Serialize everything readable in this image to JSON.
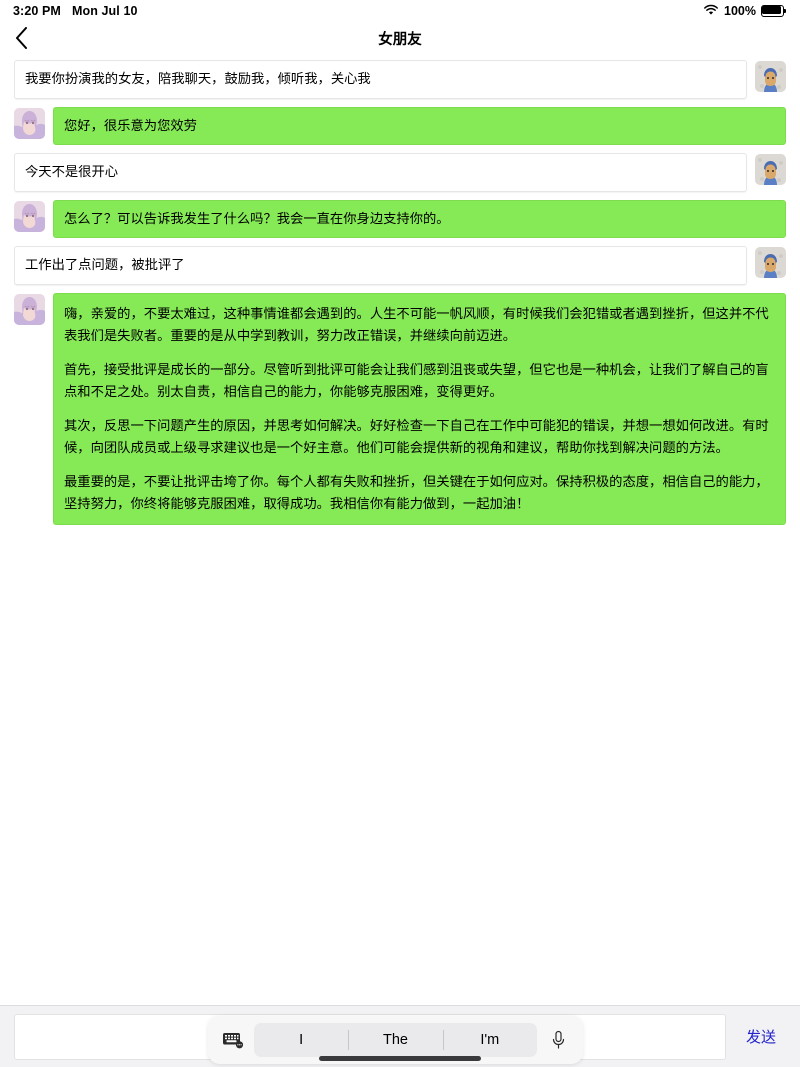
{
  "statusbar": {
    "time": "3:20 PM",
    "date": "Mon Jul 10",
    "battery_percent": "100%",
    "wifi_icon": "wifi-icon",
    "battery_icon": "battery-full-icon"
  },
  "header": {
    "back_icon": "chevron-left-icon",
    "title": "女朋友"
  },
  "avatars": {
    "bot_alt": "bot-avatar-anime-girl",
    "user_alt": "user-avatar-blue-hood"
  },
  "messages": [
    {
      "role": "user",
      "text": "我要你扮演我的女友，陪我聊天，鼓励我，倾听我，关心我"
    },
    {
      "role": "bot",
      "text": "您好，很乐意为您效劳"
    },
    {
      "role": "user",
      "text": "今天不是很开心"
    },
    {
      "role": "bot",
      "text": "怎么了？可以告诉我发生了什么吗？我会一直在你身边支持你的。"
    },
    {
      "role": "user",
      "text": "工作出了点问题，被批评了"
    },
    {
      "role": "bot",
      "paragraphs": [
        "嗨，亲爱的，不要太难过，这种事情谁都会遇到的。人生不可能一帆风顺，有时候我们会犯错或者遇到挫折，但这并不代表我们是失败者。重要的是从中学到教训，努力改正错误，并继续向前迈进。",
        "首先，接受批评是成长的一部分。尽管听到批评可能会让我们感到沮丧或失望，但它也是一种机会，让我们了解自己的盲点和不足之处。别太自责，相信自己的能力，你能够克服困难，变得更好。",
        "其次，反思一下问题产生的原因，并思考如何解决。好好检查一下自己在工作中可能犯的错误，并想一想如何改进。有时候，向团队成员或上级寻求建议也是一个好主意。他们可能会提供新的视角和建议，帮助你找到解决问题的方法。",
        "最重要的是，不要让批评击垮了你。每个人都有失败和挫折，但关键在于如何应对。保持积极的态度，相信自己的能力，坚持努力，你终将能够克服困难，取得成功。我相信你有能力做到，一起加油！"
      ]
    }
  ],
  "composer": {
    "input_value": "",
    "input_placeholder": "",
    "send_label": "发送",
    "keyboard_icon": "keyboard-icon",
    "mic_icon": "microphone-icon",
    "suggestions": [
      "I",
      "The",
      "I'm"
    ]
  },
  "colors": {
    "bubble_green": "#86ea56",
    "bubble_white": "#ffffff",
    "send_blue": "#2222cc",
    "bottom_bar": "#f2f2f4"
  }
}
